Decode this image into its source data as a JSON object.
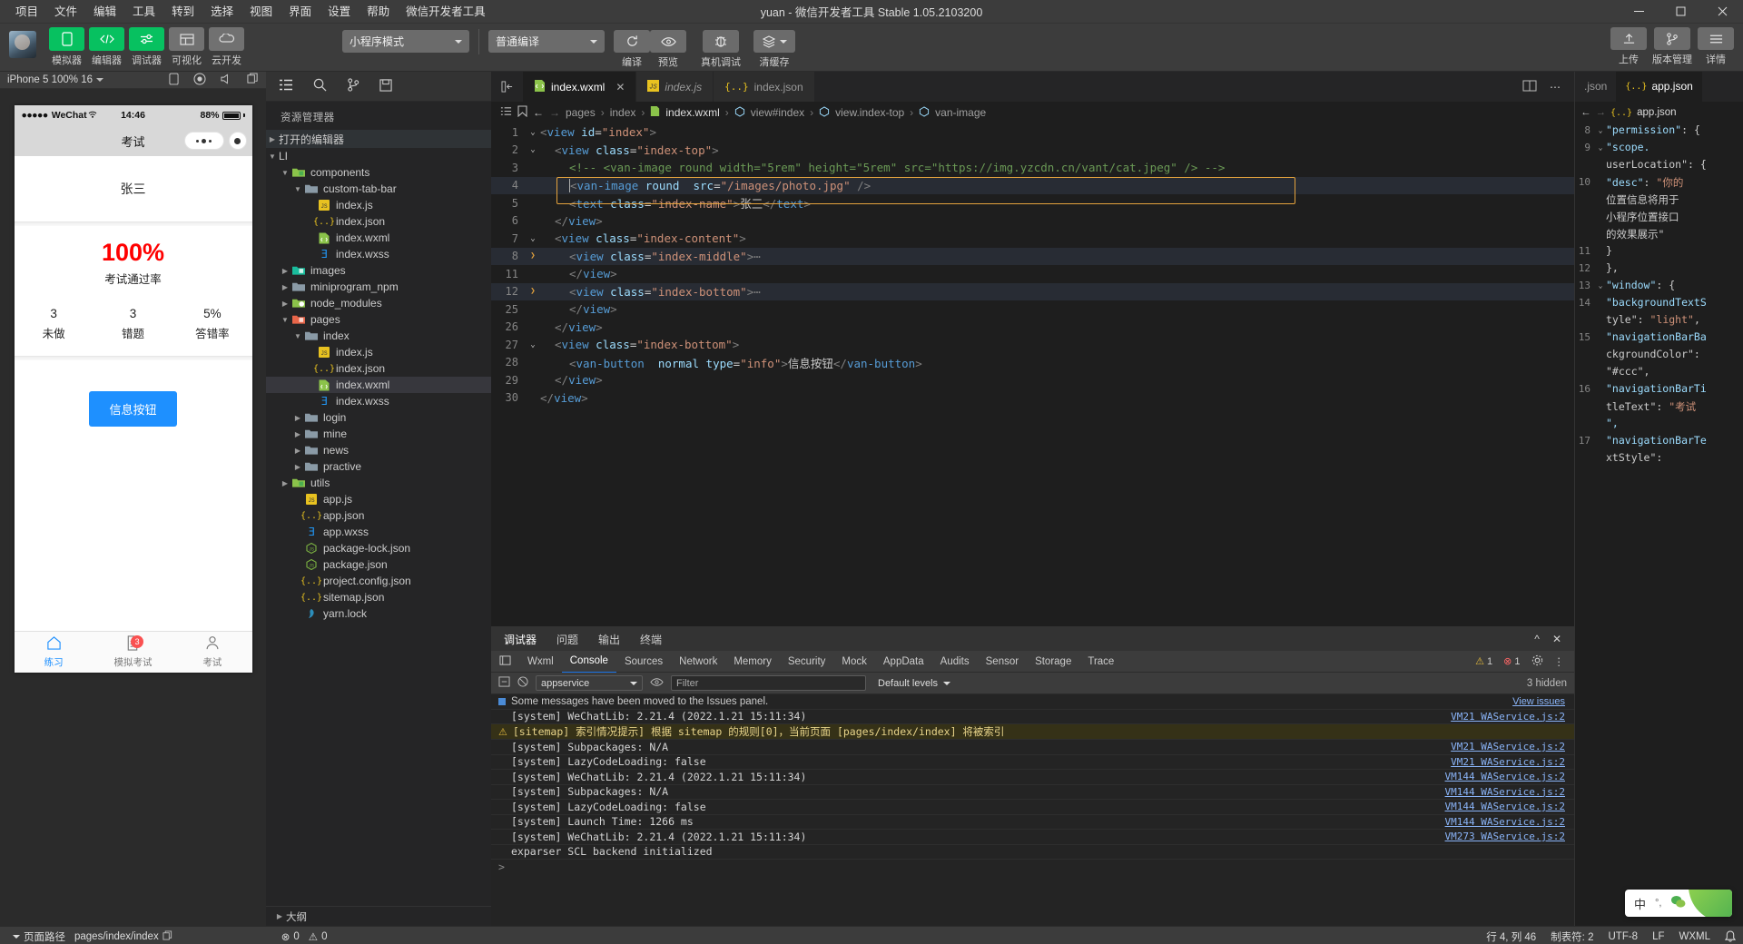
{
  "titlebar": {
    "menus": [
      "项目",
      "文件",
      "编辑",
      "工具",
      "转到",
      "选择",
      "视图",
      "界面",
      "设置",
      "帮助",
      "微信开发者工具"
    ],
    "window_title": "yuan - 微信开发者工具 Stable 1.05.2103200",
    "minimize": "–",
    "maximize": "❐",
    "close": "✕"
  },
  "toolbar": {
    "mode_buttons": [
      {
        "label": "模拟器",
        "icon": "phone-icon",
        "style": "green"
      },
      {
        "label": "编辑器",
        "icon": "code-icon",
        "style": "green"
      },
      {
        "label": "调试器",
        "icon": "sliders-icon",
        "style": "green"
      },
      {
        "label": "可视化",
        "icon": "layout-icon",
        "style": "grey"
      },
      {
        "label": "云开发",
        "icon": "cloud-icon",
        "style": "grey"
      }
    ],
    "mode_select": "小程序模式",
    "compile_select": "普通编译",
    "compile_label": "编译",
    "preview_label": "预览",
    "realdevice_label": "真机调试",
    "clearcache_label": "清缓存",
    "upload_label": "上传",
    "version_label": "版本管理",
    "detail_label": "详情"
  },
  "simulator": {
    "device_select": "iPhone 5 100% 16",
    "status_carrier": "WeChat",
    "status_time": "14:46",
    "status_battery": "88%",
    "nav_title": "考试",
    "user_name": "张三",
    "pass_rate": "100%",
    "pass_rate_label": "考试通过率",
    "stats": [
      {
        "value": "3",
        "label": "未做"
      },
      {
        "value": "3",
        "label": "错题"
      },
      {
        "value": "5%",
        "label": "答错率"
      }
    ],
    "info_button": "信息按钮",
    "tabs": [
      {
        "label": "练习",
        "icon": "home-icon",
        "active": true,
        "badge": ""
      },
      {
        "label": "模拟考试",
        "icon": "file-icon",
        "active": false,
        "badge": "3"
      },
      {
        "label": "考试",
        "icon": "user-icon",
        "active": false,
        "badge": ""
      }
    ]
  },
  "explorer": {
    "icons": [
      "files-icon",
      "search-icon",
      "source-control-icon",
      "save-icon"
    ],
    "title": "资源管理器",
    "open_editors": "打开的编辑器",
    "root": "LI",
    "outline": "大纲",
    "tree": [
      {
        "name": "components",
        "indent": 1,
        "type": "folder-green",
        "twisty": "open"
      },
      {
        "name": "custom-tab-bar",
        "indent": 2,
        "type": "folder-plain",
        "twisty": "open"
      },
      {
        "name": "index.js",
        "indent": 3,
        "type": "js"
      },
      {
        "name": "index.json",
        "indent": 3,
        "type": "json"
      },
      {
        "name": "index.wxml",
        "indent": 3,
        "type": "wxml"
      },
      {
        "name": "index.wxss",
        "indent": 3,
        "type": "wxss"
      },
      {
        "name": "images",
        "indent": 1,
        "type": "folder-teal",
        "twisty": "closed"
      },
      {
        "name": "miniprogram_npm",
        "indent": 1,
        "type": "folder-plain",
        "twisty": "closed"
      },
      {
        "name": "node_modules",
        "indent": 1,
        "type": "folder-node",
        "twisty": "closed"
      },
      {
        "name": "pages",
        "indent": 1,
        "type": "folder-red",
        "twisty": "open"
      },
      {
        "name": "index",
        "indent": 2,
        "type": "folder-plain",
        "twisty": "open"
      },
      {
        "name": "index.js",
        "indent": 3,
        "type": "js"
      },
      {
        "name": "index.json",
        "indent": 3,
        "type": "json"
      },
      {
        "name": "index.wxml",
        "indent": 3,
        "type": "wxml",
        "selected": true
      },
      {
        "name": "index.wxss",
        "indent": 3,
        "type": "wxss"
      },
      {
        "name": "login",
        "indent": 2,
        "type": "folder-plain",
        "twisty": "closed"
      },
      {
        "name": "mine",
        "indent": 2,
        "type": "folder-plain",
        "twisty": "closed"
      },
      {
        "name": "news",
        "indent": 2,
        "type": "folder-plain",
        "twisty": "closed"
      },
      {
        "name": "practive",
        "indent": 2,
        "type": "folder-plain",
        "twisty": "closed"
      },
      {
        "name": "utils",
        "indent": 1,
        "type": "folder-green",
        "twisty": "closed"
      },
      {
        "name": "app.js",
        "indent": 2,
        "type": "js"
      },
      {
        "name": "app.json",
        "indent": 2,
        "type": "json"
      },
      {
        "name": "app.wxss",
        "indent": 2,
        "type": "wxss"
      },
      {
        "name": "package-lock.json",
        "indent": 2,
        "type": "npm"
      },
      {
        "name": "package.json",
        "indent": 2,
        "type": "npm"
      },
      {
        "name": "project.config.json",
        "indent": 2,
        "type": "json"
      },
      {
        "name": "sitemap.json",
        "indent": 2,
        "type": "json"
      },
      {
        "name": "yarn.lock",
        "indent": 2,
        "type": "yarn"
      }
    ]
  },
  "editor": {
    "tabs": [
      {
        "label": "index.wxml",
        "type": "wxml",
        "active": true,
        "close": "✕"
      },
      {
        "label": "index.js",
        "type": "js",
        "active": false,
        "italic": true
      },
      {
        "label": "index.json",
        "type": "json",
        "active": false
      }
    ],
    "breadcrumb": [
      "pages",
      "index",
      "index.wxml",
      "view#index",
      "view.index-top",
      "van-image"
    ],
    "lines": [
      {
        "no": "1",
        "fold": "v",
        "indent": 0,
        "code": "<view id=\"index\">"
      },
      {
        "no": "2",
        "fold": "v",
        "indent": 1,
        "code": "<view class=\"index-top\">"
      },
      {
        "no": "3",
        "fold": "",
        "indent": 2,
        "code": "<!-- <van-image round width=\"5rem\" height=\"5rem\" src=\"https://img.yzcdn.cn/vant/cat.jpeg\" /> -->",
        "comment": true
      },
      {
        "no": "4",
        "fold": "",
        "indent": 2,
        "code": "<van-image round  src=\"/images/photo.jpg\" />",
        "cursor": true
      },
      {
        "no": "5",
        "fold": "",
        "indent": 2,
        "code": "<text class=\"index-name\">张三</text>"
      },
      {
        "no": "6",
        "fold": "",
        "indent": 1,
        "code": "</view>"
      },
      {
        "no": "7",
        "fold": "v",
        "indent": 1,
        "code": "<view class=\"index-content\">"
      },
      {
        "no": "8",
        "fold": ">",
        "indent": 2,
        "code": "<view class=\"index-middle\">⋯",
        "folded": true
      },
      {
        "no": "11",
        "fold": "",
        "indent": 2,
        "code": "</view>"
      },
      {
        "no": "12",
        "fold": ">",
        "indent": 2,
        "code": "<view class=\"index-bottom\">⋯",
        "folded": true
      },
      {
        "no": "25",
        "fold": "",
        "indent": 2,
        "code": "</view>"
      },
      {
        "no": "26",
        "fold": "",
        "indent": 1,
        "code": "</view>"
      },
      {
        "no": "27",
        "fold": "v",
        "indent": 1,
        "code": "<view class=\"index-bottom\">"
      },
      {
        "no": "28",
        "fold": "",
        "indent": 2,
        "code": "<van-button  normal type=\"info\">信息按钮</van-button>"
      },
      {
        "no": "29",
        "fold": "",
        "indent": 1,
        "code": "</view>"
      },
      {
        "no": "30",
        "fold": "",
        "indent": 0,
        "code": "</view>"
      }
    ]
  },
  "debugger": {
    "tabs": [
      "调试器",
      "问题",
      "输出",
      "终端"
    ],
    "active_tab": "调试器",
    "devtools_tabs": [
      "Wxml",
      "Console",
      "Sources",
      "Network",
      "Memory",
      "Security",
      "Mock",
      "AppData",
      "Audits",
      "Sensor",
      "Storage",
      "Trace"
    ],
    "devtools_active": "Console",
    "warning_count": "1",
    "error_count": "1",
    "context_select": "appservice",
    "filter_placeholder": "Filter",
    "levels_select": "Default levels",
    "hidden_count": "3 hidden",
    "issues_banner": "Some messages have been moved to the Issues panel.",
    "view_issues": "View issues",
    "logs": [
      {
        "text": "[system] WeChatLib: 2.21.4 (2022.1.21 15:11:34)",
        "src": "VM21 WAService.js:2",
        "level": "info"
      },
      {
        "text": "[sitemap] 索引情况提示] 根据 sitemap 的规则[0]，当前页面 [pages/index/index] 将被索引",
        "src": "",
        "level": "warn"
      },
      {
        "text": "[system] Subpackages: N/A",
        "src": "VM21 WAService.js:2",
        "level": "info"
      },
      {
        "text": "[system] LazyCodeLoading: false",
        "src": "VM21 WAService.js:2",
        "level": "info"
      },
      {
        "text": "[system] WeChatLib: 2.21.4 (2022.1.21 15:11:34)",
        "src": "VM144 WAService.js:2",
        "level": "info"
      },
      {
        "text": "[system] Subpackages: N/A",
        "src": "VM144 WAService.js:2",
        "level": "info"
      },
      {
        "text": "[system] LazyCodeLoading: false",
        "src": "VM144 WAService.js:2",
        "level": "info"
      },
      {
        "text": "[system] Launch Time: 1266 ms",
        "src": "VM144 WAService.js:2",
        "level": "info"
      },
      {
        "text": "[system] WeChatLib: 2.21.4 (2022.1.21 15:11:34)",
        "src": "VM273 WAService.js:2",
        "level": "info"
      },
      {
        "text": "exparser SCL backend initialized",
        "src": "",
        "level": "info"
      }
    ],
    "prompt": ">"
  },
  "rightpanel": {
    "tab_partial": ".json",
    "tab_active": "app.json",
    "breadcrumb_last": "app.json",
    "lines": [
      {
        "no": "8",
        "fold": "v",
        "text": "\"permission\": {"
      },
      {
        "no": "9",
        "fold": "v",
        "text": "\"scope."
      },
      {
        "no": "",
        "fold": "",
        "text": "userLocation\": {"
      },
      {
        "no": "10",
        "fold": "",
        "text": "\"desc\": \"你的"
      },
      {
        "no": "",
        "fold": "",
        "text": "位置信息将用于"
      },
      {
        "no": "",
        "fold": "",
        "text": "小程序位置接口"
      },
      {
        "no": "",
        "fold": "",
        "text": "的效果展示\""
      },
      {
        "no": "11",
        "fold": "",
        "text": "}"
      },
      {
        "no": "12",
        "fold": "",
        "text": "},"
      },
      {
        "no": "13",
        "fold": "v",
        "text": "\"window\": {"
      },
      {
        "no": "14",
        "fold": "",
        "text": "\"backgroundTextS"
      },
      {
        "no": "",
        "fold": "",
        "text": "tyle\": \"light\","
      },
      {
        "no": "15",
        "fold": "",
        "text": "\"navigationBarBa"
      },
      {
        "no": "",
        "fold": "",
        "text": "ckgroundColor\":"
      },
      {
        "no": "",
        "fold": "",
        "text": "\"#ccc\","
      },
      {
        "no": "16",
        "fold": "",
        "text": "\"navigationBarTi"
      },
      {
        "no": "",
        "fold": "",
        "text": "tleText\": \"考试"
      },
      {
        "no": "",
        "fold": "",
        "text": "\","
      },
      {
        "no": "17",
        "fold": "",
        "text": "\"navigationBarTe"
      },
      {
        "no": "",
        "fold": "",
        "text": "xtStyle\":"
      }
    ]
  },
  "statusbar": {
    "path_label": "页面路径",
    "path_value": "pages/index/index",
    "problems_errors": "0",
    "problems_warnings": "0",
    "cursor_pos": "行 4, 列 46",
    "spaces": "制表符: 2",
    "encoding": "UTF-8",
    "eol": "LF",
    "language": "WXML",
    "bell": "🔔"
  },
  "ime": {
    "mode": "中",
    "punct": "°,",
    "icon": "wechat-icon"
  }
}
